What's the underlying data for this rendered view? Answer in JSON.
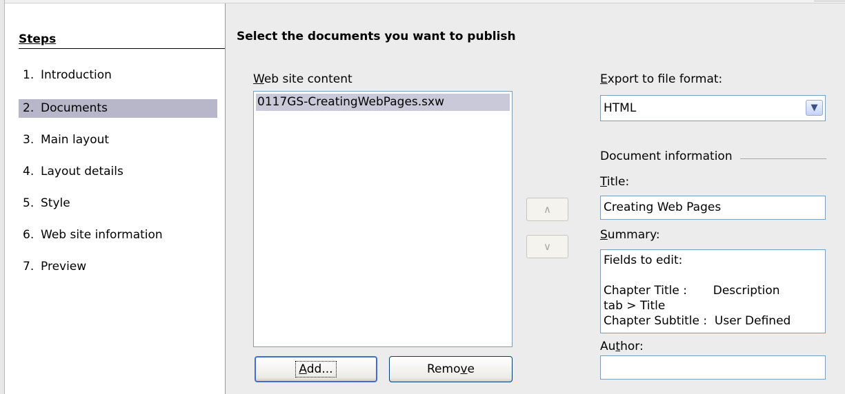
{
  "steps": {
    "header": "Steps",
    "items": [
      {
        "num": "1.",
        "label": "Introduction"
      },
      {
        "num": "2.",
        "label": "Documents"
      },
      {
        "num": "3.",
        "label": "Main layout"
      },
      {
        "num": "4.",
        "label": "Layout details"
      },
      {
        "num": "5.",
        "label": "Style"
      },
      {
        "num": "6.",
        "label": "Web site information"
      },
      {
        "num": "7.",
        "label": "Preview"
      }
    ],
    "selected": 1
  },
  "main": {
    "title": "Select the documents you want to publish",
    "content_label_u": "W",
    "content_label_rest": "eb site content",
    "list_items": [
      "0117GS-CreatingWebPages.sxw"
    ],
    "add_u": "A",
    "add_rest": "dd...",
    "remove_pre": "Remo",
    "remove_u": "v",
    "remove_post": "e",
    "up_arrow": "∧",
    "down_arrow": "∨"
  },
  "export": {
    "label_u": "E",
    "label_rest": "xport to file format:",
    "value": "HTML"
  },
  "docinfo": {
    "group_label": "Document information",
    "title_label_u": "T",
    "title_label_rest": "itle:",
    "title_value": "Creating Web Pages",
    "summary_label_u": "S",
    "summary_label_rest": "ummary:",
    "summary_value": "Fields to edit:\n\nChapter Title :       Description\ntab > Title\nChapter Subtitle :  User Defined",
    "author_label_pre": "Au",
    "author_label_u": "t",
    "author_label_post": "hor:",
    "author_value": ""
  },
  "colors": {
    "selected_step_bg": "#b7b7c9",
    "selected_list_bg": "#c9c9d9",
    "button_border": "#003c74",
    "default_button_border": "#3d6fd3",
    "field_border": "#7f9db9"
  }
}
